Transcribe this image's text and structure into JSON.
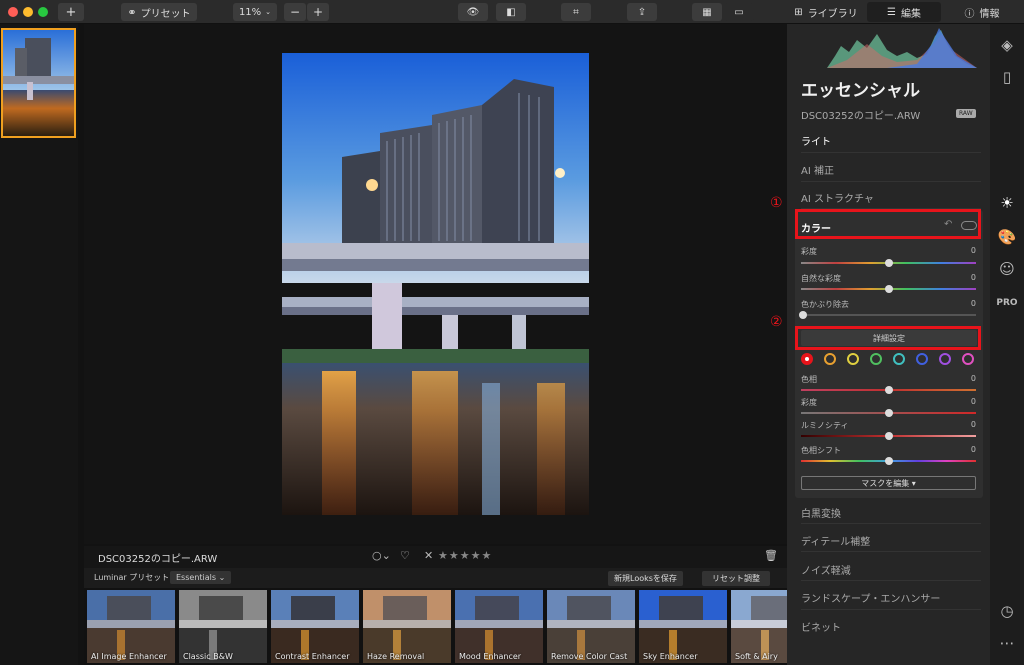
{
  "toolbar": {
    "add_label": "+",
    "preset_label": "プリセット",
    "zoom_label": "11%",
    "zoom_out": "−",
    "zoom_in": "+",
    "library_label": "ライブラリ",
    "edit_label": "編集",
    "info_label": "情報"
  },
  "panel": {
    "title": "エッセンシャル",
    "filename": "DSC03252のコピー.ARW",
    "raw_badge": "RAW",
    "sections": [
      "ライト",
      "AI 補正",
      "AI ストラクチャ"
    ],
    "color_section": "カラー",
    "color_sliders": [
      {
        "label": "彩度",
        "value": "0"
      },
      {
        "label": "自然な彩度",
        "value": "0"
      },
      {
        "label": "色かぶり除去",
        "value": "0"
      }
    ],
    "advanced_label": "詳細設定",
    "hsl_sliders": [
      {
        "label": "色相",
        "value": "0"
      },
      {
        "label": "彩度",
        "value": "0"
      },
      {
        "label": "ルミノシティ",
        "value": "0"
      },
      {
        "label": "色相シフト",
        "value": "0"
      }
    ],
    "mask_label": "マスクを編集 ▾",
    "lower_sections": [
      "白黒変換",
      "ディテール補整",
      "ノイズ軽減",
      "ランドスケープ・エンハンサー",
      "ビネット"
    ]
  },
  "annotations": {
    "one": "①",
    "two": "②"
  },
  "infobar": {
    "filename": "DSC03252のコピー.ARW",
    "rating": "★★★★★"
  },
  "presetbar": {
    "label": "Luminar プリセット",
    "category": "Essentials ⌄",
    "save_looks": "新規Looksを保存",
    "reset": "リセット調整"
  },
  "presets": [
    "AI Image Enhancer",
    "Classic B&W",
    "Contrast Enhancer",
    "Haze Removal",
    "Mood Enhancer",
    "Remove Color Cast",
    "Sky Enhancer",
    "Soft & Airy"
  ],
  "colors": {
    "accent_red": "#e8141b",
    "selection_orange": "#f0a020",
    "hsl_circles": [
      "#e8141b",
      "#e8a030",
      "#e0d040",
      "#50c060",
      "#40c0c0",
      "#4060e0",
      "#a050e0",
      "#e050c0"
    ]
  }
}
